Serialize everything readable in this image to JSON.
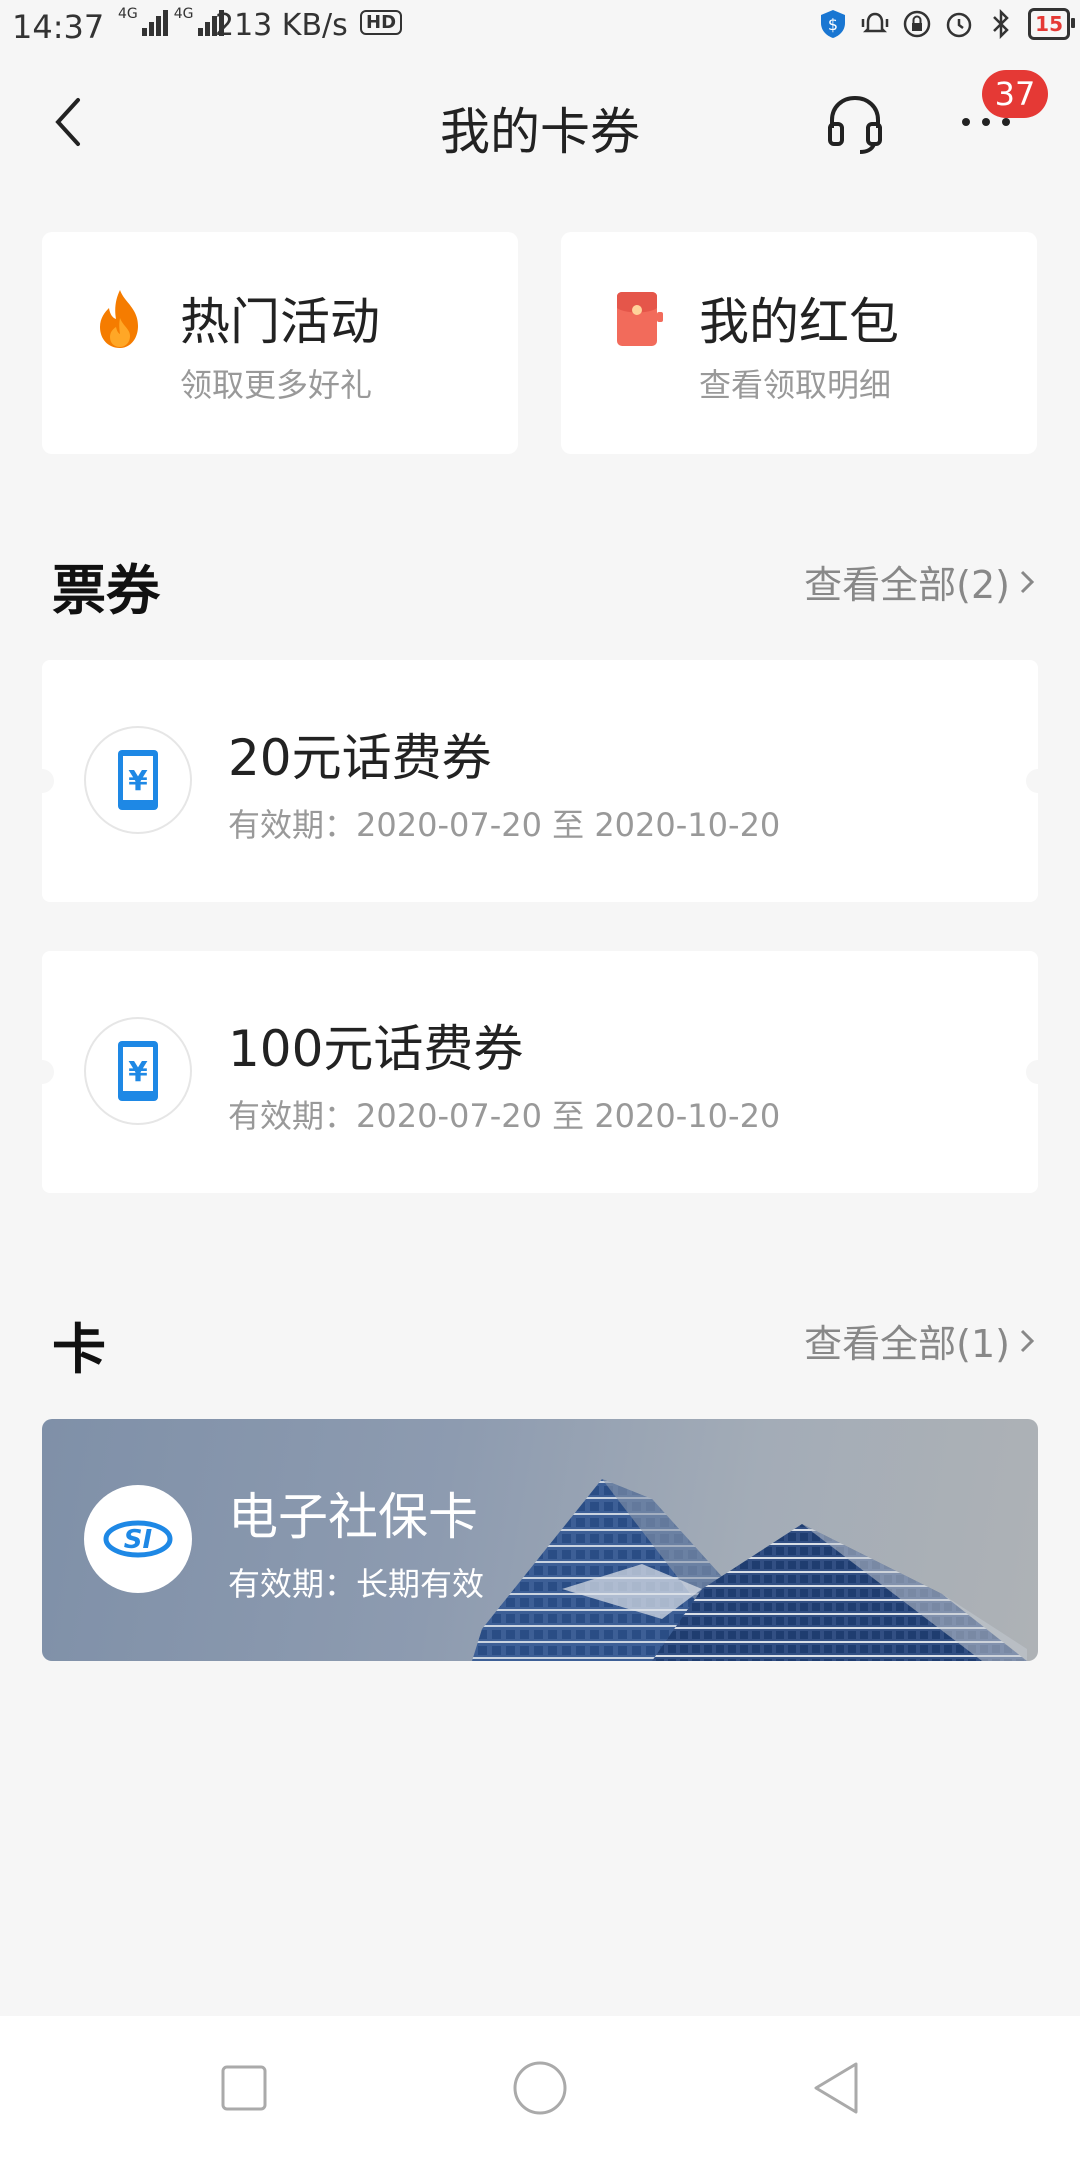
{
  "status_bar": {
    "time": "14:37",
    "net1": "4G",
    "net2": "4G",
    "speed": "213 KB/s",
    "hd": "HD",
    "battery": "15"
  },
  "header": {
    "title": "我的卡券",
    "badge_count": "37"
  },
  "top_cards": [
    {
      "title": "热门活动",
      "subtitle": "领取更多好礼",
      "icon": "fire-icon"
    },
    {
      "title": "我的红包",
      "subtitle": "查看领取明细",
      "icon": "red-packet-icon"
    }
  ],
  "coupons_section": {
    "title": "票券",
    "view_all": "查看全部(2)",
    "items": [
      {
        "title": "20元话费券",
        "validity": "有效期：2020-07-20 至 2020-10-20",
        "icon": "phone-yuan-icon"
      },
      {
        "title": "100元话费券",
        "validity": "有效期：2020-07-20 至 2020-10-20",
        "icon": "phone-yuan-icon"
      }
    ]
  },
  "cards_section": {
    "title": "卡",
    "view_all": "查看全部(1)",
    "items": [
      {
        "title": "电子社保卡",
        "validity": "有效期：长期有效",
        "icon": "social-security-logo"
      }
    ]
  },
  "colors": {
    "background": "#f6f6f6",
    "accent_red": "#e53935",
    "fire_orange": "#f57c00",
    "coupon_blue": "#1e88e5"
  }
}
